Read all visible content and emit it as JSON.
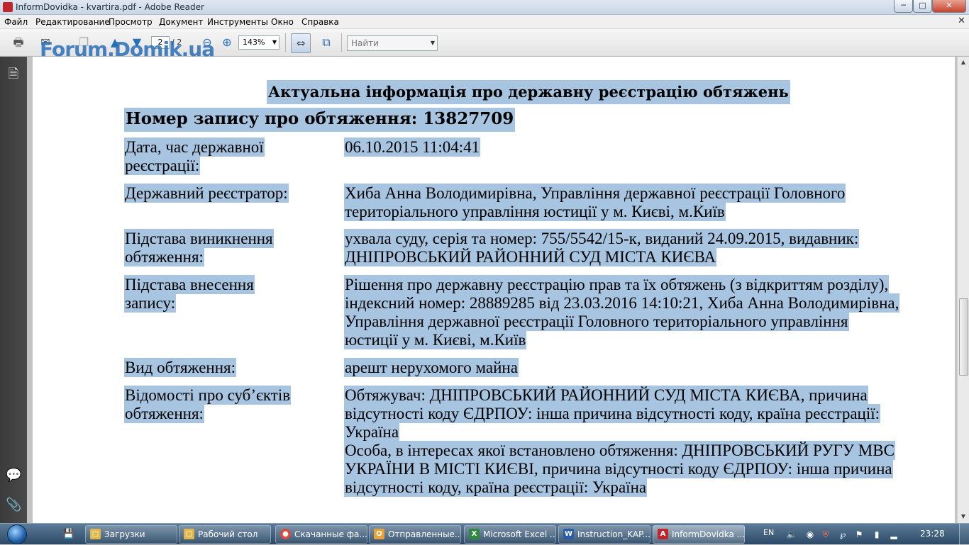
{
  "window": {
    "title": "InformDovidka - kvartira.pdf - Adobe Reader",
    "minimize_icon": "minimize-icon",
    "maximize_icon": "maximize-icon",
    "close_icon": "close-icon"
  },
  "menu": {
    "items": [
      "Файл",
      "Редактирование",
      "Просмотр",
      "Документ",
      "Инструменты",
      "Окно",
      "Справка"
    ]
  },
  "toolbar": {
    "page_current": "2",
    "page_total": "/ 2",
    "zoom": "143%",
    "search_placeholder": "Найти",
    "watermark": "Forum.Domik.ua"
  },
  "document": {
    "title": "Актуальна інформація про державну реєстрацію обтяжень",
    "record_number": "Номер запису про обтяження: 13827709",
    "rows": [
      {
        "label": "Дата, час державної реєстрації:",
        "value": "06.10.2015 11:04:41"
      },
      {
        "label": "Державний реєстратор:",
        "value": "Хиба Анна Володимирівна, Управління державної реєстрації Головного територіального управління юстиції у м. Києві, м.Київ"
      },
      {
        "label": "Підстава виникнення обтяження:",
        "value": "ухвала суду, серія та номер: 755/5542/15-к, виданий 24.09.2015, видавник: ДНІПРОВСЬКИЙ РАЙОННИЙ СУД МІСТА КИЄВА"
      },
      {
        "label": "Підстава внесення запису:",
        "value": "Рішення про державну реєстрацію прав та їх обтяжень (з відкриттям розділу), індексний номер: 28889285 від 23.03.2016 14:10:21, Хиба Анна Володимирівна, Управління державної реєстрації Головного територіального управління юстиції у м. Києві, м.Київ"
      },
      {
        "label": "Вид обтяження:",
        "value": "арешт нерухомого майна"
      },
      {
        "label": "Відомості про суб’єктів обтяження:",
        "value": "Обтяжувач: ДНІПРОВСЬКИЙ РАЙОННИЙ СУД МІСТА КИЄВА, причина відсутності коду ЄДРПОУ: інша причина відсутності коду, країна реєстрації: Україна",
        "value2": "Особа, в інтересах якої встановлено обтяження: ДНІПРОВСЬКИЙ РУГУ МВС УКРАЇНИ В МІСТІ КИЄВІ, причина відсутності коду ЄДРПОУ: інша причина відсутності коду, країна реєстрації: Україна"
      }
    ]
  },
  "taskbar": {
    "tasks": [
      "Загрузки",
      "Рабочий стол",
      "Скачанные фа...",
      "Отправленные...",
      "Microsoft Excel ...",
      "Instruction_KAP...",
      "InformDovidka ..."
    ],
    "language": "EN",
    "clock": "23:28"
  },
  "colors": {
    "selection": "#a7c4e0",
    "nav_panel": "#3b3b3b",
    "taskbar": "#2c4a67"
  }
}
